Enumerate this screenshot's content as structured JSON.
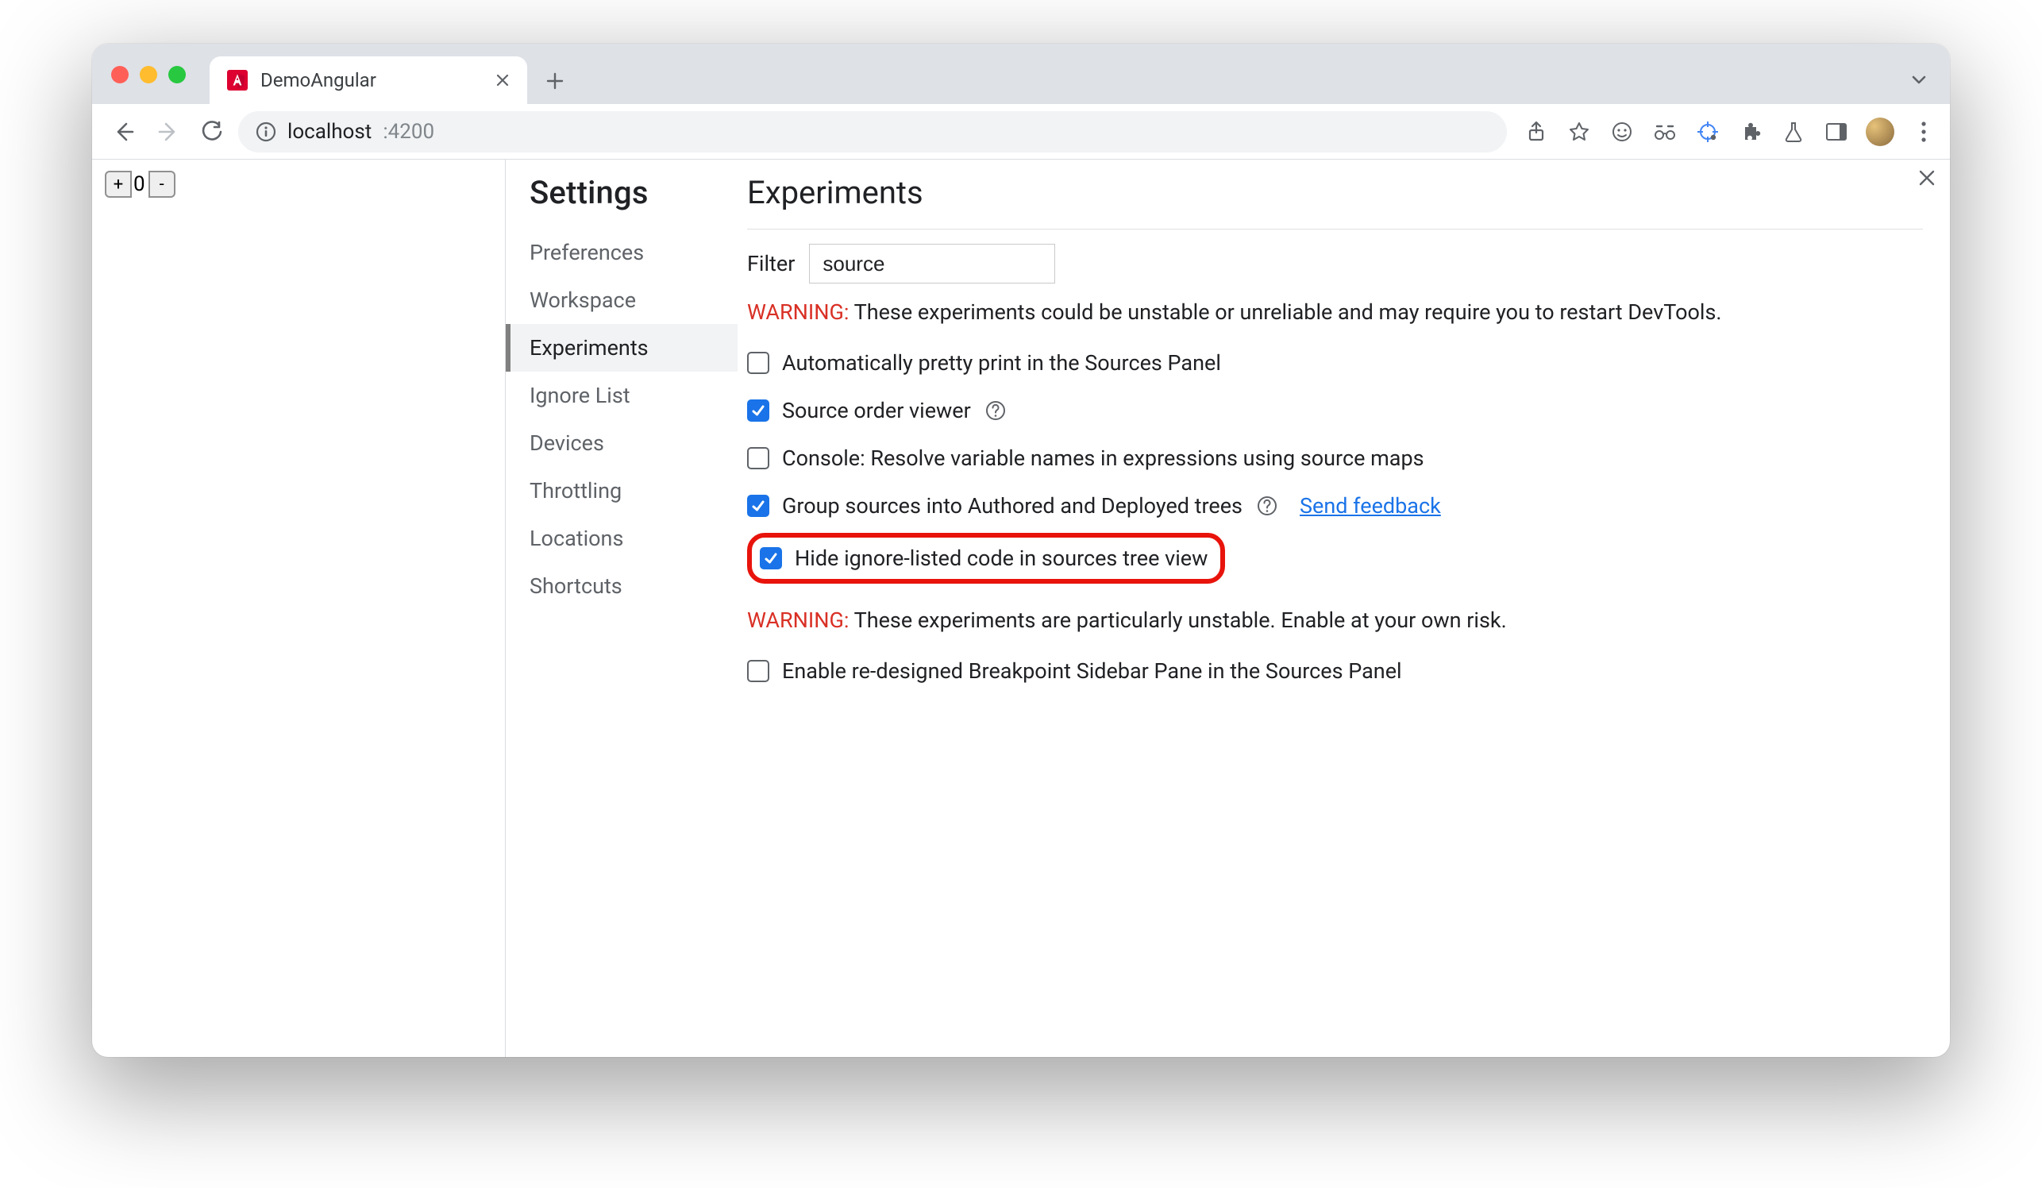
{
  "browser": {
    "tab_title": "DemoAngular",
    "url_host": "localhost",
    "url_port": ":4200"
  },
  "page": {
    "counter_value": "0",
    "plus": "+",
    "minus": "-"
  },
  "devtools": {
    "settings_title": "Settings",
    "sidebar": [
      {
        "label": "Preferences",
        "active": false
      },
      {
        "label": "Workspace",
        "active": false
      },
      {
        "label": "Experiments",
        "active": true
      },
      {
        "label": "Ignore List",
        "active": false
      },
      {
        "label": "Devices",
        "active": false
      },
      {
        "label": "Throttling",
        "active": false
      },
      {
        "label": "Locations",
        "active": false
      },
      {
        "label": "Shortcuts",
        "active": false
      }
    ],
    "main_title": "Experiments",
    "filter_label": "Filter",
    "filter_value": "source",
    "warning1_prefix": "WARNING:",
    "warning1_text": " These experiments could be unstable or unreliable and may require you to restart DevTools.",
    "warning2_prefix": "WARNING:",
    "warning2_text": " These experiments are particularly unstable. Enable at your own risk.",
    "send_feedback": "Send feedback",
    "experiments_a": [
      {
        "label": "Automatically pretty print in the Sources Panel",
        "checked": false,
        "help": false
      },
      {
        "label": "Source order viewer",
        "checked": true,
        "help": true
      },
      {
        "label": "Console: Resolve variable names in expressions using source maps",
        "checked": false,
        "help": false
      },
      {
        "label": "Group sources into Authored and Deployed trees",
        "checked": true,
        "help": true,
        "feedback": true
      },
      {
        "label": "Hide ignore-listed code in sources tree view",
        "checked": true,
        "help": false,
        "highlight": true
      }
    ],
    "experiments_b": [
      {
        "label": "Enable re-designed Breakpoint Sidebar Pane in the Sources Panel",
        "checked": false
      }
    ]
  }
}
